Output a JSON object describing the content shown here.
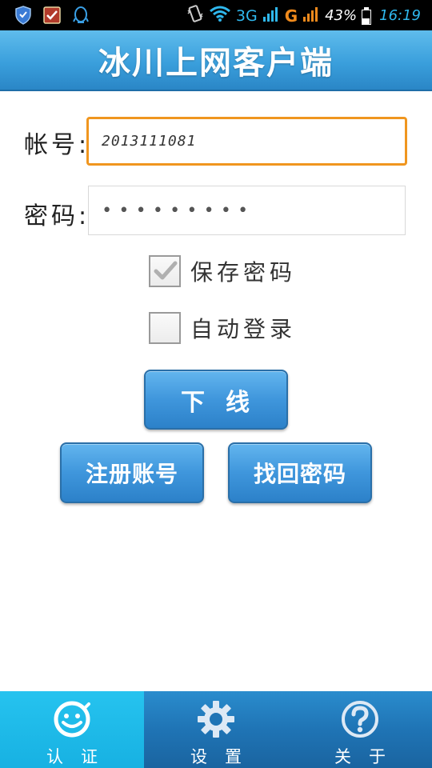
{
  "status_bar": {
    "network": "3G",
    "signal1_sup": "1",
    "network2": "G",
    "signal2_sup": "2",
    "battery": "43%",
    "time": "16:19"
  },
  "header": {
    "title": "冰川上网客户端"
  },
  "form": {
    "account_label": "帐号:",
    "account_value": "2013111081",
    "password_label": "密码:",
    "password_value": "•••••••••",
    "save_password": {
      "label": "保存密码",
      "checked": true
    },
    "auto_login": {
      "label": "自动登录",
      "checked": false
    }
  },
  "buttons": {
    "logout": "下线",
    "register": "注册账号",
    "recover": "找回密码"
  },
  "bottom_nav": {
    "tabs": [
      {
        "label": "认证",
        "icon": "smiley-auth-icon",
        "active": true
      },
      {
        "label": "设置",
        "icon": "gear-icon",
        "active": false
      },
      {
        "label": "关于",
        "icon": "question-icon",
        "active": false
      }
    ]
  },
  "colors": {
    "title_bar": "#3a9fdc",
    "account_focus_border": "#f0961f",
    "button_blue": "#3f96dc",
    "nav_bg": "#1f74b5",
    "nav_active": "#1fbbe9"
  }
}
